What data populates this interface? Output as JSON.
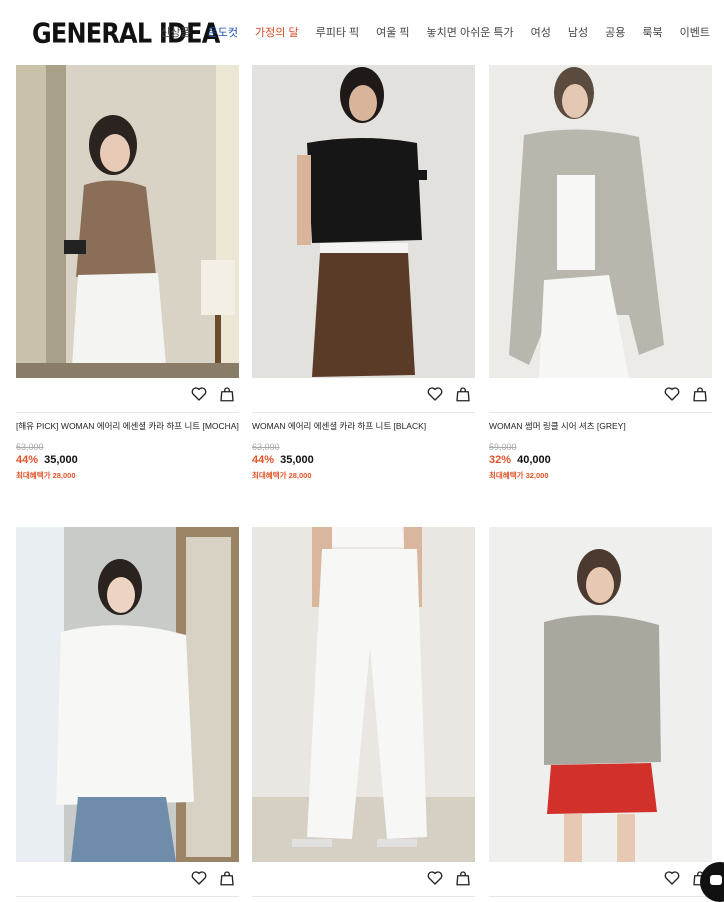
{
  "header": {
    "logo": "GENERAL IDEA",
    "nav": [
      {
        "label": "신상품",
        "color": "#444444"
      },
      {
        "label": "온도컷",
        "color": "#1e4fa8"
      },
      {
        "label": "가정의 달",
        "color": "#d34a2a"
      },
      {
        "label": "루피타 픽",
        "color": "#444444"
      },
      {
        "label": "여울 픽",
        "color": "#444444"
      },
      {
        "label": "놓치면 아쉬운 특가",
        "color": "#444444"
      },
      {
        "label": "여성",
        "color": "#444444"
      },
      {
        "label": "남성",
        "color": "#444444"
      },
      {
        "label": "공용",
        "color": "#444444"
      },
      {
        "label": "룩북",
        "color": "#444444"
      },
      {
        "label": "이벤트",
        "color": "#444444"
      }
    ]
  },
  "products": [
    {
      "title": "[해유 PICK] WOMAN 에어리 에센셜 카라 하프 니트 [MOCHA]",
      "original_price": "63,000",
      "discount": "44%",
      "price": "35,000",
      "max_benefit": "최대혜택가 28,000"
    },
    {
      "title": "WOMAN 에어리 에센셜 카라 하프 니트 [BLACK]",
      "original_price": "63,000",
      "discount": "44%",
      "price": "35,000",
      "max_benefit": "최대혜택가 28,000"
    },
    {
      "title": "WOMAN 썸머 링클 시어 셔츠 [GREY]",
      "original_price": "59,000",
      "discount": "32%",
      "price": "40,000",
      "max_benefit": "최대혜택가 32,000"
    }
  ],
  "icons": {
    "wishlist": "heart-icon",
    "cart": "shopping-bag-icon",
    "chat": "chat-icon"
  }
}
